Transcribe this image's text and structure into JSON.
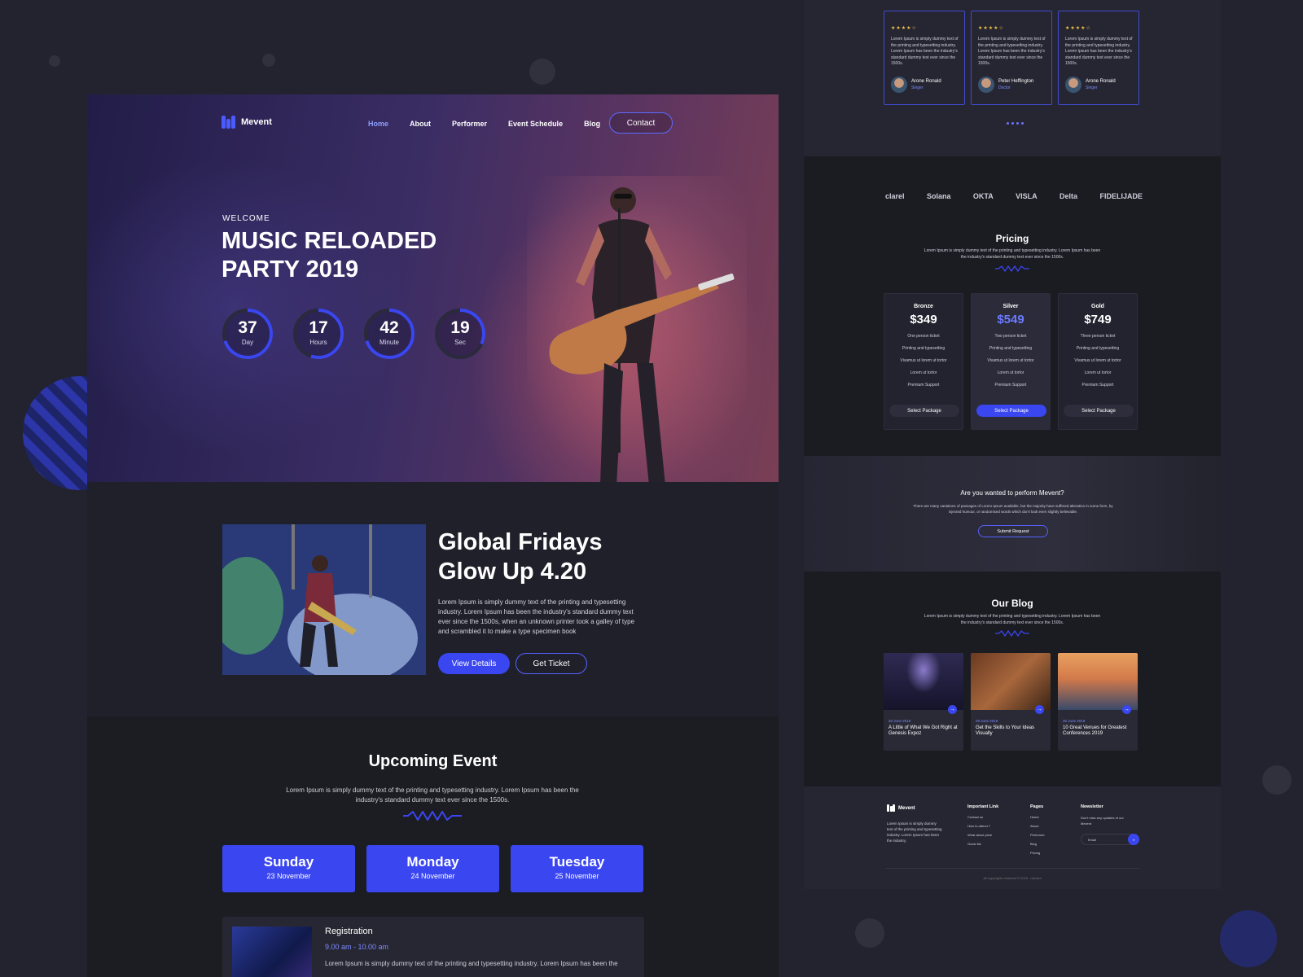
{
  "nav": {
    "brand": "Mevent",
    "links": [
      "Home",
      "About",
      "Performer",
      "Event Schedule",
      "Blog"
    ],
    "contact": "Contact"
  },
  "hero": {
    "welcome": "WELCOME",
    "title": "MUSIC RELOADED PARTY 2019",
    "countdown": [
      {
        "value": "37",
        "label": "Day",
        "progress": 0.7
      },
      {
        "value": "17",
        "label": "Hours",
        "progress": 0.55
      },
      {
        "value": "42",
        "label": "Minute",
        "progress": 0.7
      },
      {
        "value": "19",
        "label": "Sec",
        "progress": 0.32
      }
    ]
  },
  "feature": {
    "title": "Global Fridays Glow Up 4.20",
    "description": "Lorem Ipsum is simply dummy text of the printing and typesetting industry. Lorem Ipsum has been the industry's standard dummy text ever since the 1500s, when an unknown printer took a galley of type and scrambled it to make a type specimen book",
    "primary": "View Details",
    "secondary": "Get Ticket"
  },
  "upcoming": {
    "title": "Upcoming Event",
    "description": "Lorem Ipsum is simply dummy text of the printing and typesetting industry. Lorem Ipsum has been the industry's standard dummy text ever since the 1500s.",
    "days": [
      {
        "day": "Sunday",
        "date": "23 November"
      },
      {
        "day": "Monday",
        "date": "24 November"
      },
      {
        "day": "Tuesday",
        "date": "25 November"
      }
    ],
    "item": {
      "title": "Registration",
      "time": "9.00 am - 10.00 am",
      "description": "Lorem Ipsum is simply dummy text of the printing and typesetting industry. Lorem Ipsum has been the"
    }
  },
  "testimonials": {
    "stars": "★★★★☆",
    "quote": "Lorem Ipsum is simply dummy text of the printing and typesetting industry. Lorem Ipsum has been the industry's standard dummy text ever since the 1500s.",
    "people": [
      {
        "name": "Arone Ronald",
        "role": "Singer"
      },
      {
        "name": "Peter Heffington",
        "role": "Doctor"
      },
      {
        "name": "Arone Ronald",
        "role": "Singer"
      }
    ]
  },
  "brands": [
    "clarel",
    "Solana",
    "OKTA",
    "VISLA",
    "Delta",
    "FIDELIJADE"
  ],
  "pricing": {
    "title": "Pricing",
    "description": "Lorem Ipsum is simply dummy text of the printing and typesetting industry. Lorem Ipsum has been the industry's standard dummy text ever since the 1500s.",
    "plans": [
      {
        "name": "Bronze",
        "price": "$349",
        "features": [
          "One person ticket",
          "Printing and typesetting",
          "Vivamus ut lorem ut tortor",
          "Lorem ut tortor",
          "Premium Support"
        ],
        "button": "Select Package"
      },
      {
        "name": "Silver",
        "price": "$549",
        "features": [
          "Two person ticket",
          "Printing and typesetting",
          "Vivamus ut lorem ut tortor",
          "Lorem ut tortor",
          "Premium Support"
        ],
        "button": "Select Package"
      },
      {
        "name": "Gold",
        "price": "$749",
        "features": [
          "Three person ticket",
          "Printing and typesetting",
          "Vivamus ut lorem ut tortor",
          "Lorem ut tortor",
          "Premium Support"
        ],
        "button": "Select Package"
      }
    ]
  },
  "cta": {
    "title": "Are you wanted to perform Mevent?",
    "description": "There are many variations of passages of Lorem Ipsum available, but the majority have suffered alteration in some form, by injected humour, or randomised words which don't look even slightly believable.",
    "button": "Submit Request"
  },
  "blog": {
    "title": "Our Blog",
    "description": "Lorem Ipsum is simply dummy text of the printing and typesetting industry. Lorem Ipsum has been the industry's standard dummy text ever since the 1500s.",
    "posts": [
      {
        "date": "26 June 2019",
        "title": "A Little of What We Got Right at Genesis Expoz"
      },
      {
        "date": "28 June 2019",
        "title": "Get the Skills to Your Ideas Visually"
      },
      {
        "date": "30 June 2019",
        "title": "10 Great Venues for Greatest Conferences 2019"
      }
    ]
  },
  "footer": {
    "brand": "Mevent",
    "about": "Lorem Ipsum is simply dummy text of the printing and typesetting industry. Lorem Ipsum has been the industry.",
    "important_title": "Important Link",
    "important": [
      "Contact us",
      "How to attend ?",
      "What about price",
      "Guest list"
    ],
    "pages_title": "Pages",
    "pages": [
      "Home",
      "About",
      "Performer",
      "Blog",
      "Pricing"
    ],
    "newsletter_title": "Newsletter",
    "newsletter_text": "Don't miss any updates of our Mevent",
    "newsletter_placeholder": "Email",
    "copyright": "All copyrights reserved © 2019 - mevent"
  },
  "colors": {
    "accent": "#3a46f0",
    "accent_light": "#7d8bff",
    "bg": "#1c1c24"
  }
}
